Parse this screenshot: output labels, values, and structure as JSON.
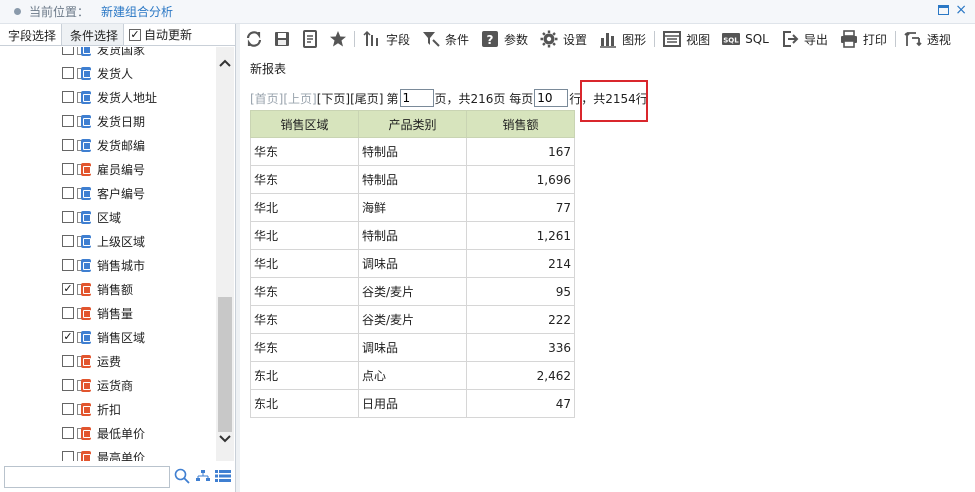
{
  "header": {
    "location_label": "当前位置：",
    "location_value": "新建组合分析"
  },
  "left_panel": {
    "tabs": [
      "字段选择",
      "条件选择"
    ],
    "auto_update_label": "自动更新",
    "auto_update_checked": true,
    "fields": [
      {
        "name": "发货国家",
        "icon": "blue",
        "checked": false
      },
      {
        "name": "发货人",
        "icon": "blue",
        "checked": false
      },
      {
        "name": "发货人地址",
        "icon": "blue",
        "checked": false
      },
      {
        "name": "发货日期",
        "icon": "blue",
        "checked": false
      },
      {
        "name": "发货邮编",
        "icon": "blue",
        "checked": false
      },
      {
        "name": "雇员编号",
        "icon": "red",
        "checked": false
      },
      {
        "name": "客户编号",
        "icon": "blue",
        "checked": false
      },
      {
        "name": "区域",
        "icon": "blue",
        "checked": false
      },
      {
        "name": "上级区域",
        "icon": "blue",
        "checked": false
      },
      {
        "name": "销售城市",
        "icon": "blue",
        "checked": false
      },
      {
        "name": "销售额",
        "icon": "red",
        "checked": true
      },
      {
        "name": "销售量",
        "icon": "red",
        "checked": false
      },
      {
        "name": "销售区域",
        "icon": "blue",
        "checked": true
      },
      {
        "name": "运费",
        "icon": "red",
        "checked": false
      },
      {
        "name": "运货商",
        "icon": "red",
        "checked": false
      },
      {
        "name": "折扣",
        "icon": "red",
        "checked": false
      },
      {
        "name": "最低单价",
        "icon": "red",
        "checked": false
      },
      {
        "name": "最高单价",
        "icon": "red",
        "checked": false
      }
    ],
    "search_value": ""
  },
  "toolbar": {
    "field": "字段",
    "condition": "条件",
    "param": "参数",
    "settings": "设置",
    "chart": "图形",
    "view": "视图",
    "sql": "SQL",
    "export": "导出",
    "print": "打印",
    "pivot": "透视"
  },
  "report": {
    "title": "新报表",
    "pager": {
      "first": "[首页]",
      "prev": "[上页]",
      "next": "[下页]",
      "last": "[尾页]",
      "page_prefix": "第",
      "page_value": "1",
      "page_suffix": "页，共216页 每页",
      "per_page_value": "10",
      "row_suffix": "行",
      "total": "，共2154行"
    },
    "columns": [
      "销售区域",
      "产品类别",
      "销售额"
    ],
    "rows": [
      [
        "华东",
        "特制品",
        "167"
      ],
      [
        "华东",
        "特制品",
        "1,696"
      ],
      [
        "华北",
        "海鲜",
        "77"
      ],
      [
        "华北",
        "特制品",
        "1,261"
      ],
      [
        "华北",
        "调味品",
        "214"
      ],
      [
        "华东",
        "谷类/麦片",
        "95"
      ],
      [
        "华东",
        "谷类/麦片",
        "222"
      ],
      [
        "华东",
        "调味品",
        "336"
      ],
      [
        "东北",
        "点心",
        "2,462"
      ],
      [
        "东北",
        "日用品",
        "47"
      ]
    ]
  },
  "colors": {
    "accent": "#2b78c5",
    "header_green": "#d7e4bd",
    "highlight_red": "#d9262c"
  }
}
